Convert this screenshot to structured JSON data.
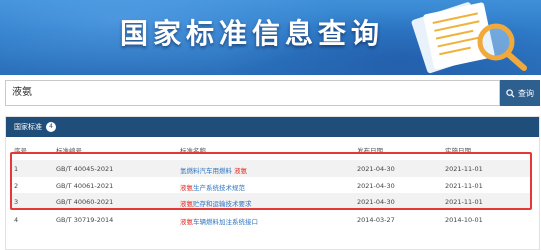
{
  "banner": {
    "title": "国家标准信息查询",
    "illustration": "document-magnifier-illustration"
  },
  "search": {
    "value": "液氨",
    "button_label": "查询",
    "button_icon": "search-icon"
  },
  "results": {
    "header_label": "国家标准",
    "count": "4",
    "columns": [
      "序号",
      "标准编号",
      "标准名称",
      "发布日期",
      "实施日期"
    ],
    "rows": [
      {
        "index": "1",
        "code": "GB/T 40045-2021",
        "name_pre": "氢燃料汽车用燃料 ",
        "name_hl": "液氨",
        "name_post": "",
        "published": "2021-04-30",
        "effective": "2021-11-01"
      },
      {
        "index": "2",
        "code": "GB/T 40061-2021",
        "name_pre": "",
        "name_hl": "液氨",
        "name_post": "生产系统技术规范",
        "published": "2021-04-30",
        "effective": "2021-11-01"
      },
      {
        "index": "3",
        "code": "GB/T 40060-2021",
        "name_pre": "",
        "name_hl": "液氨",
        "name_post": "贮存和运输技术要求",
        "published": "2021-04-30",
        "effective": "2021-11-01"
      },
      {
        "index": "4",
        "code": "GB/T 30719-2014",
        "name_pre": "",
        "name_hl": "液氨",
        "name_post": "车辆燃料加注系统接口",
        "published": "2014-03-27",
        "effective": "2014-10-01"
      }
    ]
  },
  "colors": {
    "banner_blue": "#2f7cc9",
    "panel_header": "#1f4e7a",
    "link_blue": "#2f74c0",
    "keyword_red": "#e0312a",
    "highlight_border": "#e53935"
  }
}
